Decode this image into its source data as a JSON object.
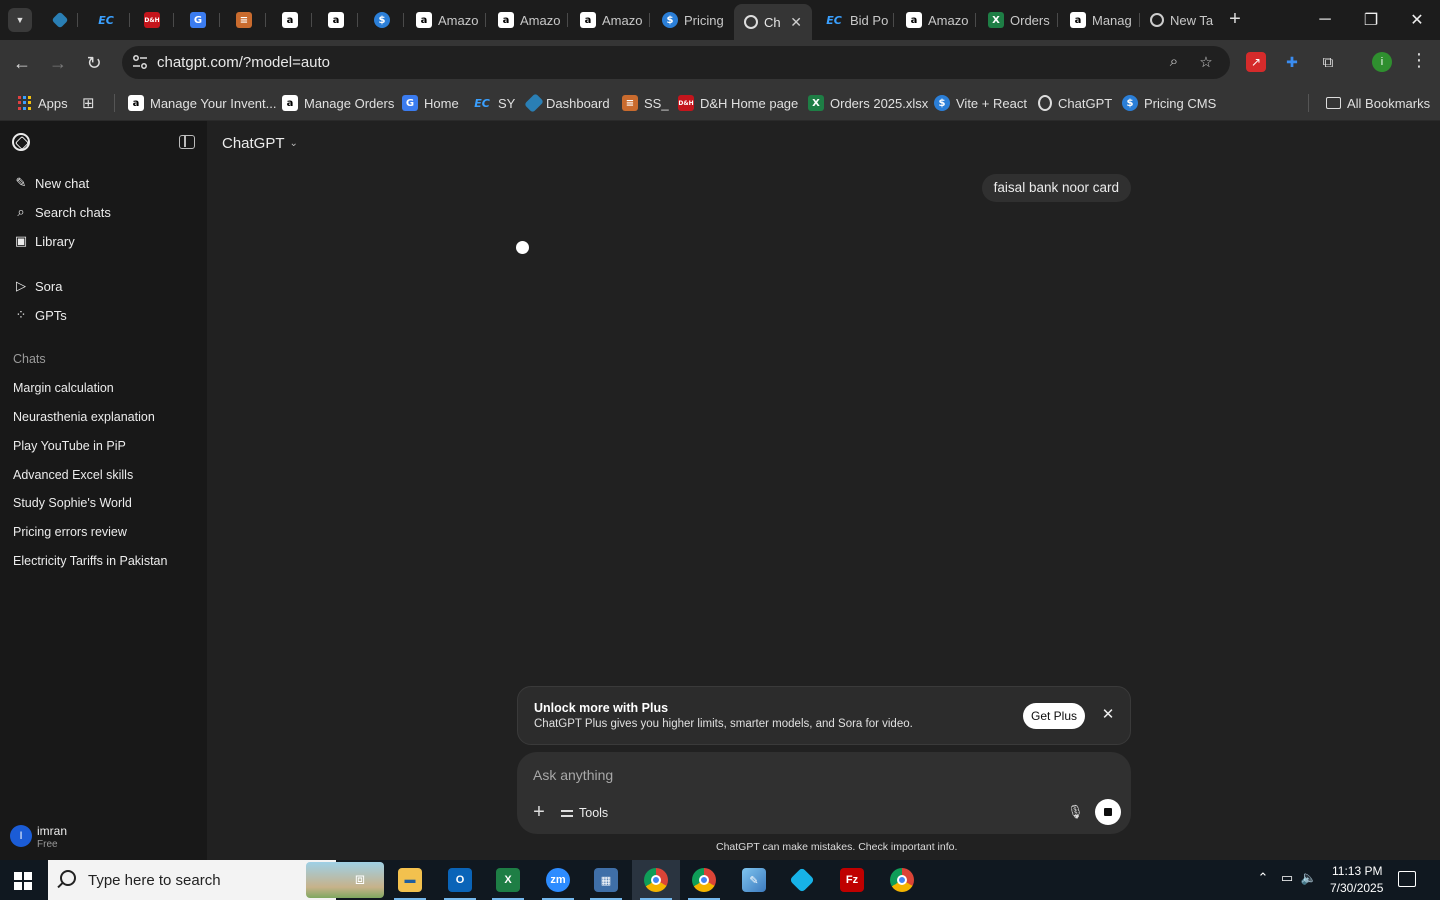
{
  "browser": {
    "tabs": [
      {
        "label": "",
        "icon": "k-icon"
      },
      {
        "label": "",
        "icon": "ec-icon"
      },
      {
        "label": "",
        "icon": "dh-icon"
      },
      {
        "label": "",
        "icon": "g-icon"
      },
      {
        "label": "",
        "icon": "stack-icon"
      },
      {
        "label": "",
        "icon": "amazon-icon"
      },
      {
        "label": "",
        "icon": "amazon-icon"
      },
      {
        "label": "",
        "icon": "dollar-icon"
      },
      {
        "label": "Amazo",
        "icon": "amazon-icon"
      },
      {
        "label": "Amazo",
        "icon": "amazon-icon"
      },
      {
        "label": "Amazo",
        "icon": "amazon-icon"
      },
      {
        "label": "Pricing",
        "icon": "dollar-icon"
      },
      {
        "label": "Ch",
        "icon": "chatgpt-icon",
        "active": true
      },
      {
        "label": "Bid Po",
        "icon": "ec-icon"
      },
      {
        "label": "Amazo",
        "icon": "amazon-icon"
      },
      {
        "label": "Orders",
        "icon": "excel-icon"
      },
      {
        "label": "Manag",
        "icon": "amazon-icon"
      },
      {
        "label": "New Ta",
        "icon": "globe-icon"
      }
    ],
    "url": "chatgpt.com/?model=auto",
    "profile_initial": "i",
    "bookmarks": [
      {
        "label": "Apps"
      },
      {
        "label": "Manage Your Invent..."
      },
      {
        "label": "Manage Orders"
      },
      {
        "label": "Home"
      },
      {
        "label": "SY"
      },
      {
        "label": "Dashboard"
      },
      {
        "label": "SS_"
      },
      {
        "label": "D&H Home page"
      },
      {
        "label": "Orders 2025.xlsx"
      },
      {
        "label": "Vite + React"
      },
      {
        "label": "ChatGPT"
      },
      {
        "label": "Pricing CMS"
      },
      {
        "label": "All Bookmarks"
      }
    ]
  },
  "sidebar": {
    "nav": [
      {
        "label": "New chat"
      },
      {
        "label": "Search chats"
      },
      {
        "label": "Library"
      },
      {
        "label": "Sora"
      },
      {
        "label": "GPTs"
      }
    ],
    "chats_heading": "Chats",
    "chats": [
      "Margin calculation",
      "Neurasthenia explanation",
      "Play YouTube in PiP",
      "Advanced Excel skills",
      "Study Sophie's World",
      "Pricing errors review",
      "Electricity Tariffs in Pakistan"
    ],
    "user": {
      "initial": "I",
      "name": "imran",
      "plan": "Free"
    }
  },
  "main": {
    "model_label": "ChatGPT",
    "user_message": "faisal bank noor card",
    "banner": {
      "title": "Unlock more with Plus",
      "description": "ChatGPT Plus gives you higher limits, smarter models, and Sora for video.",
      "button": "Get Plus"
    },
    "composer": {
      "placeholder": "Ask anything",
      "tools_label": "Tools"
    },
    "disclaimer": "ChatGPT can make mistakes. Check important info."
  },
  "taskbar": {
    "search_placeholder": "Type here to search",
    "time": "11:13 PM",
    "date": "7/30/2025"
  },
  "colors": {
    "accent_blue": "#1b5cd6",
    "page_bg": "#212121",
    "sidebar_bg": "#181818"
  }
}
